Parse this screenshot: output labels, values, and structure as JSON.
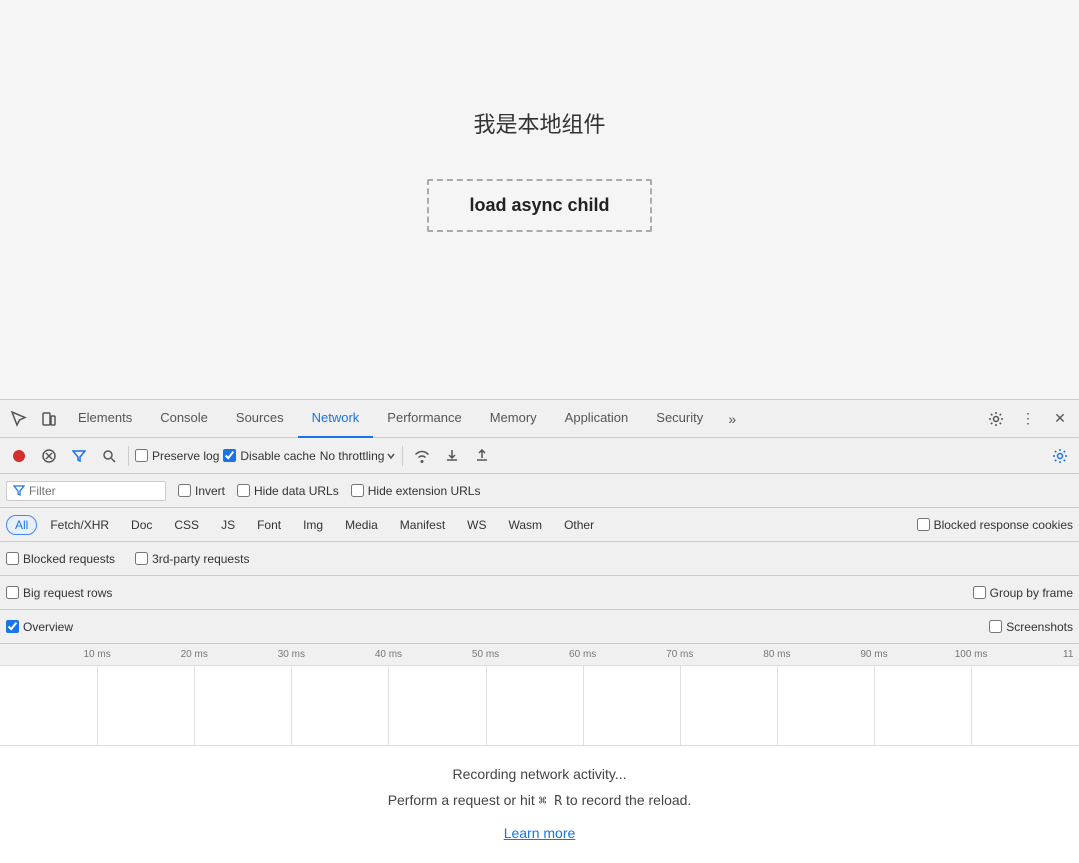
{
  "page": {
    "title": "我是本地组件",
    "button_label": "load async child"
  },
  "devtools": {
    "tabs": [
      {
        "label": "Elements",
        "active": false
      },
      {
        "label": "Console",
        "active": false
      },
      {
        "label": "Sources",
        "active": false
      },
      {
        "label": "Network",
        "active": true
      },
      {
        "label": "Performance",
        "active": false
      },
      {
        "label": "Memory",
        "active": false
      },
      {
        "label": "Application",
        "active": false
      },
      {
        "label": "Security",
        "active": false
      }
    ],
    "toolbar": {
      "preserve_log_label": "Preserve log",
      "disable_cache_label": "Disable cache",
      "throttle_label": "No throttling"
    },
    "filter": {
      "placeholder": "Filter",
      "invert_label": "Invert",
      "hide_data_urls_label": "Hide data URLs",
      "hide_extension_urls_label": "Hide extension URLs"
    },
    "type_filters": [
      "All",
      "Fetch/XHR",
      "Doc",
      "CSS",
      "JS",
      "Font",
      "Img",
      "Media",
      "Manifest",
      "WS",
      "Wasm",
      "Other"
    ],
    "active_type": "All",
    "blocked_cookies_label": "Blocked response cookies",
    "options": {
      "blocked_requests_label": "Blocked requests",
      "third_party_label": "3rd-party requests",
      "big_rows_label": "Big request rows",
      "group_by_frame_label": "Group by frame",
      "overview_label": "Overview",
      "screenshots_label": "Screenshots"
    },
    "timeline_ticks": [
      "10 ms",
      "20 ms",
      "30 ms",
      "40 ms",
      "50 ms",
      "60 ms",
      "70 ms",
      "80 ms",
      "90 ms",
      "100 ms",
      "11"
    ],
    "empty_state": {
      "line1": "Recording network activity...",
      "line2": "Perform a request or hit",
      "key": "⌘ R",
      "line2_end": "to record the reload.",
      "learn_more": "Learn more"
    }
  }
}
